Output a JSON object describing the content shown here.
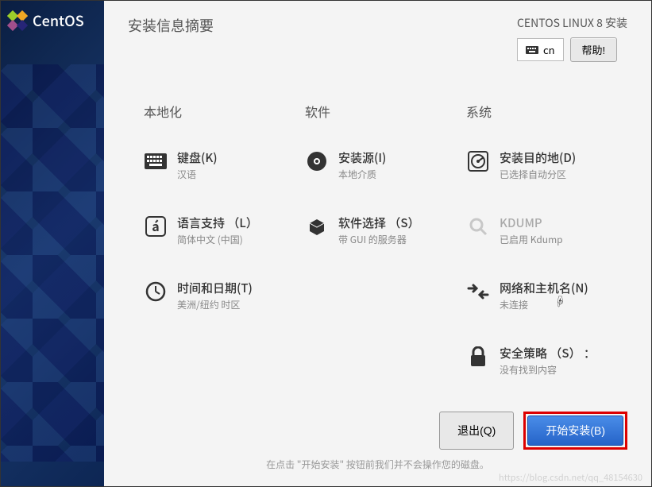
{
  "sidebar": {
    "logo_text": "CentOS"
  },
  "header": {
    "title": "安装信息摘要",
    "subtitle": "CENTOS LINUX 8 安装",
    "keyboard_indicator": "cn",
    "help_label": "帮助!"
  },
  "categories": {
    "localization": {
      "label": "本地化",
      "keyboard": {
        "title": "键盘(K)",
        "status": "汉语"
      },
      "language": {
        "title": "语言支持 （L）",
        "status": "简体中文 (中国)"
      },
      "time": {
        "title": "时间和日期(T)",
        "status": "美洲/纽约 时区"
      }
    },
    "software": {
      "label": "软件",
      "source": {
        "title": "安装源(I)",
        "status": "本地介质"
      },
      "selection": {
        "title": "软件选择 （S）",
        "status": "带 GUI 的服务器"
      }
    },
    "system": {
      "label": "系统",
      "destination": {
        "title": "安装目的地(D)",
        "status": "已选择自动分区"
      },
      "kdump": {
        "title": "KDUMP",
        "status": "已启用 Kdump"
      },
      "network": {
        "title": "网络和主机名(N)",
        "status": "未连接"
      },
      "security": {
        "title": "安全策略 （S） ：",
        "status": "没有找到内容"
      }
    }
  },
  "footer": {
    "quit_label": "退出(Q)",
    "begin_label": "开始安装(B)",
    "hint": "在点击 \"开始安装\" 按钮前我们并不会操作您的磁盘。"
  },
  "watermark": "https://blog.csdn.net/qq_48154630"
}
